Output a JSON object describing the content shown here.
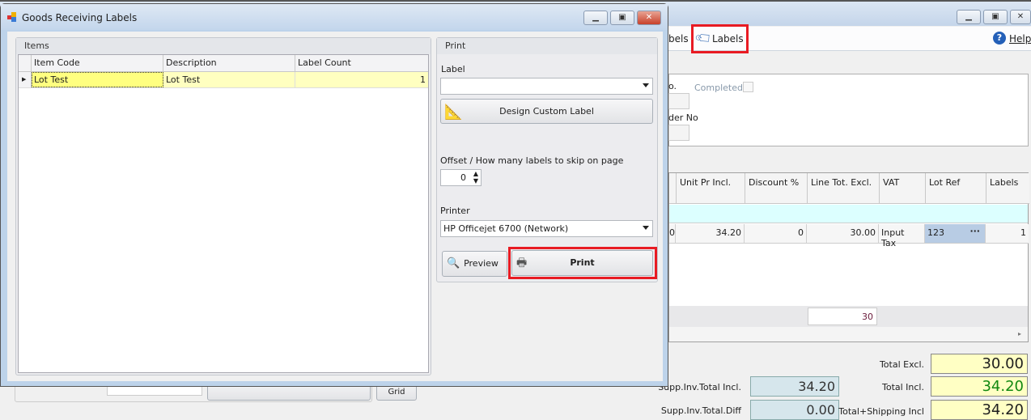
{
  "background_window": {
    "toolbar": {
      "prev_item_partial": "bels",
      "labels": "Labels",
      "help": "Help"
    },
    "form": {
      "no_label_partial": "o.",
      "completed_label": "Completed",
      "order_no_label_partial": "der No"
    },
    "grid": {
      "columns": [
        "Unit Pr Incl.",
        "Discount %",
        "Line Tot. Excl.",
        "VAT",
        "Lot Ref",
        "Labels"
      ],
      "row": {
        "partial_first": "0",
        "unit_pr_incl": "34.20",
        "discount": "0",
        "line_tot_excl": "30.00",
        "vat": "Input Tax",
        "lot_ref": "123",
        "labels": "1"
      },
      "footer_total": "30"
    },
    "totals": {
      "supp_inv_total_incl_label": "Supp.Inv.Total Incl.",
      "supp_inv_total_incl": "34.20",
      "supp_inv_total_diff_label": "Supp.Inv.Total.Diff",
      "supp_inv_total_diff": "0.00",
      "total_excl_label": "Total Excl.",
      "total_excl": "30.00",
      "total_incl_label": "Total Incl.",
      "total_incl": "34.20",
      "total_shipping_incl_label": "Total+Shipping Incl",
      "total_shipping_incl": "34.20"
    },
    "grid_button_partial": "Grid"
  },
  "dialog": {
    "title": "Goods Receiving Labels",
    "items": {
      "group_title": "Items",
      "columns": [
        "Item Code",
        "Description",
        "Label Count"
      ],
      "rows": [
        {
          "item_code": "Lot Test",
          "description": "Lot Test",
          "label_count": "1"
        }
      ]
    },
    "print": {
      "group_title": "Print",
      "label_label": "Label",
      "label_value": "",
      "design_button": "Design Custom Label",
      "offset_label": "Offset / How many labels to skip on page",
      "offset_value": "0",
      "printer_label": "Printer",
      "printer_value": "HP Officejet 6700 (Network)",
      "preview_button": "Preview",
      "print_button": "Print"
    }
  },
  "colors": {
    "highlight": "#e81b23",
    "selected_row": "#ffffc0",
    "total_incl": "#118811"
  }
}
